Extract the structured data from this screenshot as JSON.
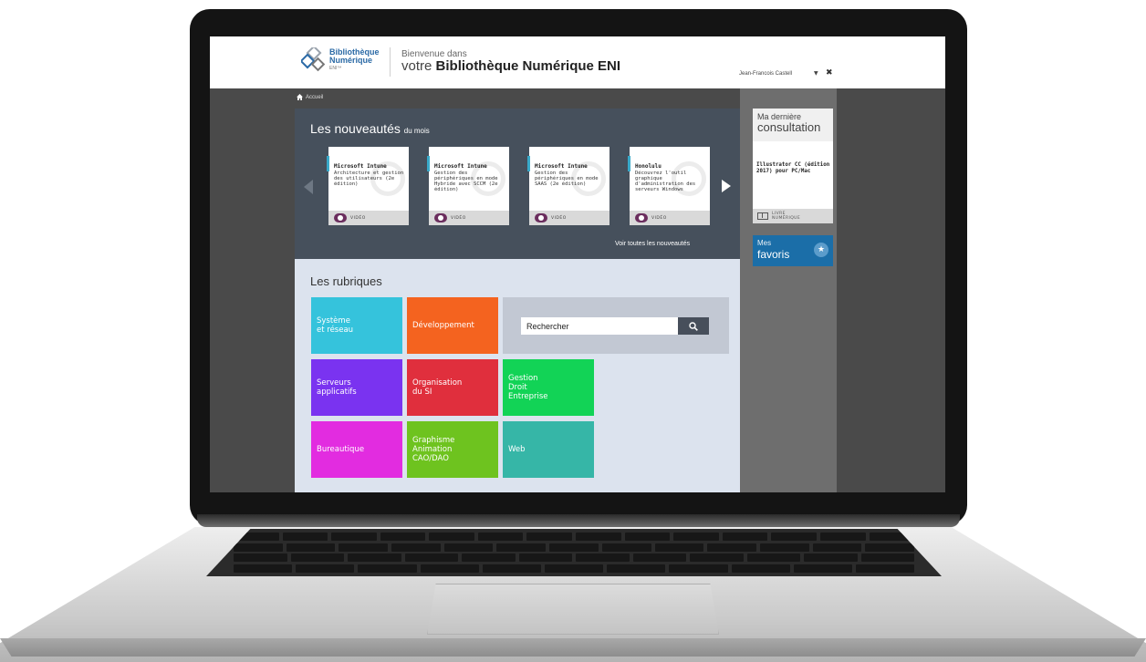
{
  "header": {
    "logo_line1": "Bibliothèque",
    "logo_line2": "Numérique",
    "logo_line3": "ENI™",
    "welcome_top": "Bienvenue dans",
    "welcome_prefix": "votre",
    "welcome_brand": "Bibliothèque Numérique ENI",
    "user_name": "Jean-Francois Castell",
    "user_caret": "▼",
    "close_symbol": "✖"
  },
  "breadcrumb": {
    "home_label": "Accueil"
  },
  "news": {
    "title": "Les nouveautés",
    "title_suffix": "du mois",
    "see_all": "Voir toutes les nouveautés",
    "cards": [
      {
        "title": "Microsoft Intune",
        "description": "Architecture et gestion des utilisateurs (2e édition)",
        "type": "VIDÉO"
      },
      {
        "title": "Microsoft Intune",
        "description": "Gestion des périphériques en mode Hybride avec SCCM (2e édition)",
        "type": "VIDÉO"
      },
      {
        "title": "Microsoft Intune",
        "description": "Gestion des périphériques en mode SAAS (2e édition)",
        "type": "VIDÉO"
      },
      {
        "title": "Honolulu",
        "description": "Découvrez l'outil graphique d'administration des serveurs Windows",
        "type": "VIDÉO"
      }
    ]
  },
  "rubriques": {
    "title": "Les rubriques",
    "tiles": [
      {
        "label": "Système\net réseau",
        "color": "#35c3dc"
      },
      {
        "label": "Développement",
        "color": "#f4631f"
      },
      {
        "label": "Serveurs\napplicatifs",
        "color": "#7a33f0"
      },
      {
        "label": "Organisation\ndu SI",
        "color": "#e02f3d"
      },
      {
        "label": "Gestion\nDroit\nEntreprise",
        "color": "#12d356"
      },
      {
        "label": "Bureautique",
        "color": "#e22ce0"
      },
      {
        "label": "Graphisme\nAnimation\nCAO/DAO",
        "color": "#6ec31f"
      },
      {
        "label": "Web",
        "color": "#36b6a7"
      }
    ],
    "search_placeholder": "Rechercher"
  },
  "sidebar": {
    "last_line1": "Ma dernière",
    "last_line2": "consultation",
    "last_title": "Illustrator CC (édition 2017) pour PC/Mac",
    "last_type_line1": "LIVRE",
    "last_type_line2": "NUMÉRIQUE",
    "favoris_line1": "Mes",
    "favoris_line2": "favoris",
    "favoris_star": "★"
  }
}
